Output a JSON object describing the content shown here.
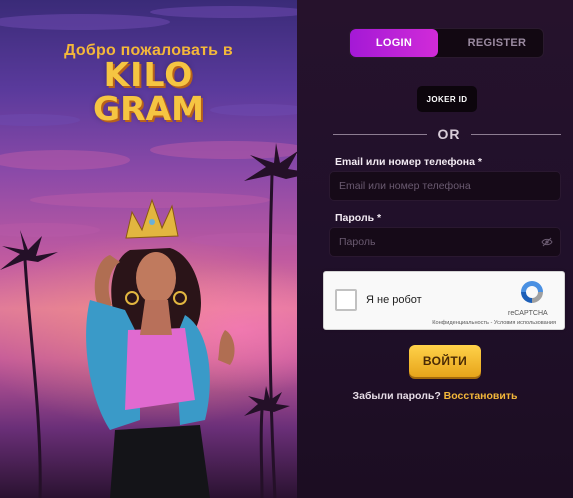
{
  "hero": {
    "welcome": "Добро пожаловать в",
    "logo_line1": "KILO",
    "logo_line2": "GRAM"
  },
  "tabs": [
    {
      "label": "LOGIN",
      "active": true
    },
    {
      "label": "REGISTER",
      "active": false
    }
  ],
  "joker_id_label": "JOKER ID",
  "divider_text": "OR",
  "form": {
    "email_label": "Email или номер телефона *",
    "email_placeholder": "Email или номер телефона",
    "password_label": "Пароль *",
    "password_placeholder": "Пароль"
  },
  "captcha": {
    "checkbox_text": "Я не робот",
    "brand": "reCAPTCHA",
    "links": "Конфиденциальность - Условия использования"
  },
  "submit_label": "ВОЙТИ",
  "forgot": {
    "question": "Забыли пароль?",
    "link": "Восстановить"
  },
  "colors": {
    "accent_gold": "#f4b73a",
    "tab_active": "#c024d8",
    "panel_bg": "#20102a"
  }
}
